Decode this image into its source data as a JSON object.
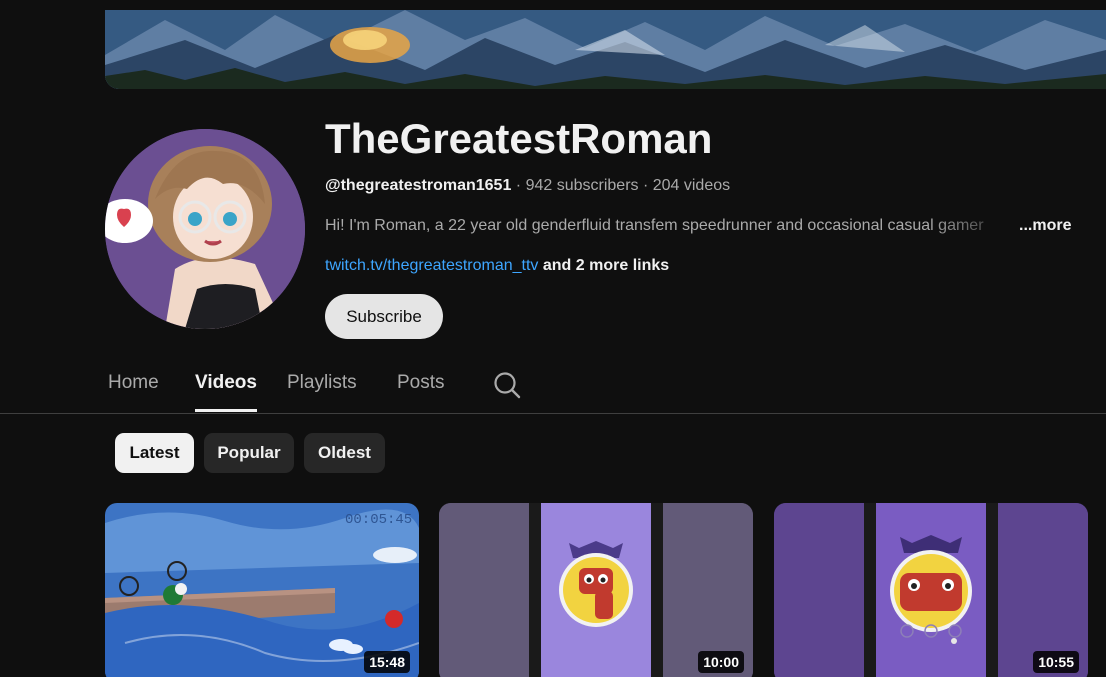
{
  "channel": {
    "name": "TheGreatestRoman",
    "handle": "@thegreatestroman1651",
    "stats": "· 942 subscribers · 204 videos",
    "description": "Hi! I'm Roman, a 22 year old genderfluid transfem speedrunner and occasional casual gamer",
    "more_label": "...more",
    "link_text": "twitch.tv/thegreatestroman_ttv",
    "more_links_text": " and 2 more links",
    "subscribe_label": "Subscribe"
  },
  "tabs": [
    {
      "label": "Home"
    },
    {
      "label": "Videos"
    },
    {
      "label": "Playlists"
    },
    {
      "label": "Posts"
    }
  ],
  "active_tab": "Videos",
  "chips": [
    {
      "label": "Latest"
    },
    {
      "label": "Popular"
    },
    {
      "label": "Oldest"
    }
  ],
  "videos": [
    {
      "duration": "15:48",
      "overlay_timer": "00:05:45"
    },
    {
      "duration": "10:00"
    },
    {
      "duration": "10:55"
    }
  ],
  "colors": {
    "background": "#0f0f0f",
    "link": "#3ea6ff",
    "secondary_text": "#aaaaaa",
    "chip_active": "#f1f1f1",
    "chip_inactive": "#272727"
  },
  "icons": {
    "search": "search-icon"
  }
}
